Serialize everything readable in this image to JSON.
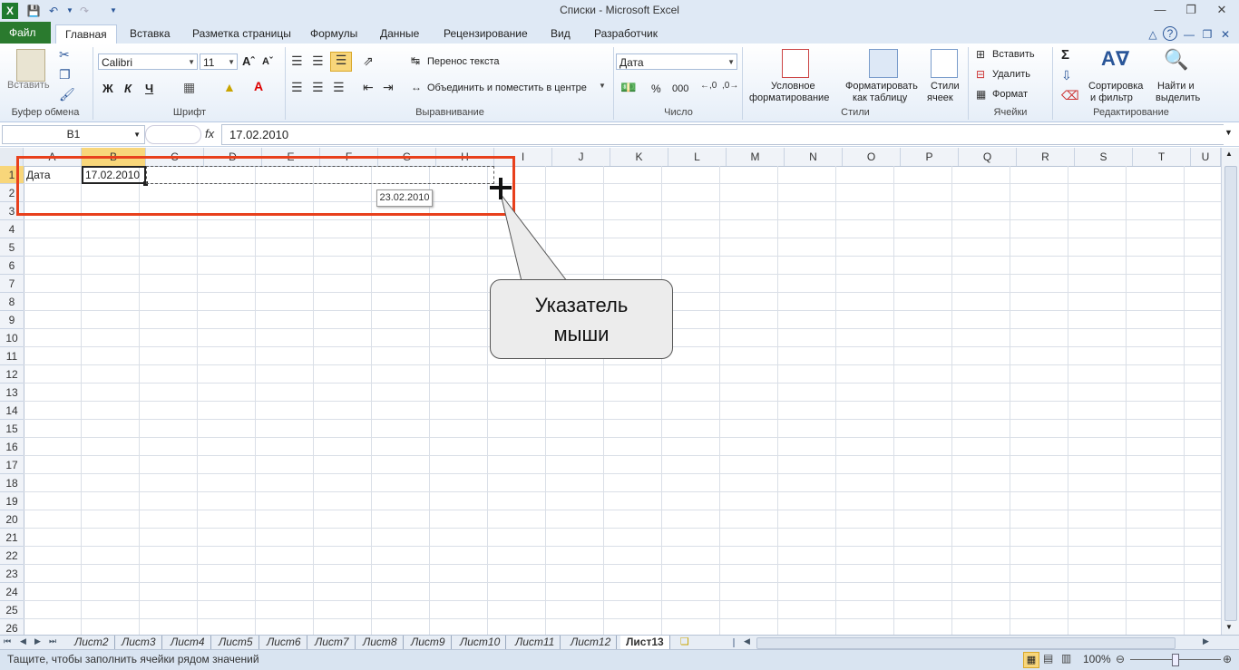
{
  "window": {
    "title": "Списки  -  Microsoft Excel"
  },
  "tabs": [
    "Файл",
    "Главная",
    "Вставка",
    "Разметка страницы",
    "Формулы",
    "Данные",
    "Рецензирование",
    "Вид",
    "Разработчик"
  ],
  "ribbon": {
    "clipboard": {
      "label": "Буфер обмена",
      "paste": "Вставить"
    },
    "font": {
      "label": "Шрифт",
      "name": "Calibri",
      "size": "11",
      "bold": "Ж",
      "italic": "К",
      "underline": "Ч"
    },
    "alignment": {
      "label": "Выравнивание",
      "wrap": "Перенос текста",
      "merge": "Объединить и поместить в центре"
    },
    "number": {
      "label": "Число",
      "format": "Дата",
      "percent": "%",
      "thousands": "000"
    },
    "styles": {
      "label": "Стили",
      "conditional_1": "Условное",
      "conditional_2": "форматирование",
      "table_1": "Форматировать",
      "table_2": "как таблицу",
      "cell_1": "Стили",
      "cell_2": "ячеек"
    },
    "cells": {
      "label": "Ячейки",
      "insert": "Вставить",
      "delete": "Удалить",
      "format": "Формат"
    },
    "editing": {
      "label": "Редактирование",
      "sort_1": "Сортировка",
      "sort_2": "и фильтр",
      "find_1": "Найти и",
      "find_2": "выделить"
    }
  },
  "formula_bar": {
    "name_box": "B1",
    "fx": "fx",
    "value": "17.02.2010"
  },
  "columns": [
    "A",
    "B",
    "C",
    "D",
    "E",
    "F",
    "G",
    "H",
    "I",
    "J",
    "K",
    "L",
    "M",
    "N",
    "O",
    "P",
    "Q",
    "R",
    "S",
    "T",
    "U"
  ],
  "rows": [
    "1",
    "2",
    "3",
    "4",
    "5",
    "6",
    "7",
    "8",
    "9",
    "10",
    "11",
    "12",
    "13",
    "14",
    "15",
    "16",
    "17",
    "18",
    "19",
    "20",
    "21",
    "22",
    "23",
    "24",
    "25",
    "26"
  ],
  "cells": {
    "A1": "Дата",
    "B1": "17.02.2010"
  },
  "fill_tooltip": "23.02.2010",
  "callout": {
    "line1": "Указатель",
    "line2": "мыши"
  },
  "sheets": [
    "Лист2",
    "Лист3",
    "Лист4",
    "Лист5",
    "Лист6",
    "Лист7",
    "Лист8",
    "Лист9",
    "Лист10",
    "Лист11",
    "Лист12",
    "Лист13"
  ],
  "active_sheet": "Лист13",
  "status": {
    "message": "Тащите, чтобы заполнить ячейки рядом значений",
    "zoom": "100%"
  },
  "colors": {
    "file_tab": "#2a7a2e",
    "selection_header": "#f8d67a",
    "annotation": "#e8401c"
  }
}
